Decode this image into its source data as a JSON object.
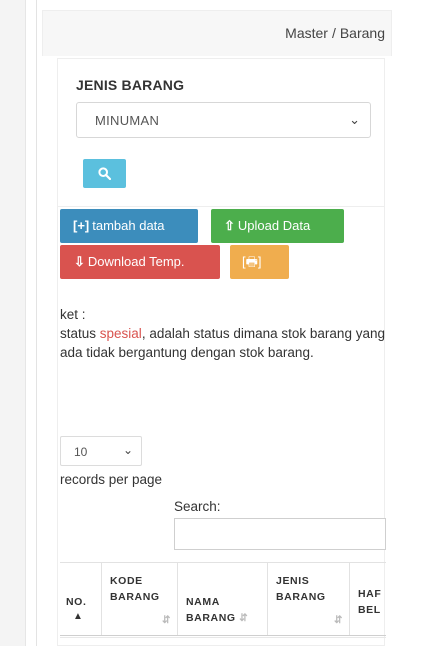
{
  "breadcrumb": {
    "parent": "Master",
    "separator": "/",
    "current": "Barang"
  },
  "filter": {
    "label": "JENIS BARANG",
    "selected": "MINUMAN"
  },
  "search_button": {
    "icon": "search-icon"
  },
  "buttons": {
    "tambah": "tambah data",
    "tambah_icon": "[+]",
    "upload": "Upload Data",
    "download": "Download Temp.",
    "print_icon": "[🖶]"
  },
  "colors": {
    "primary": "#3c8dbc",
    "success": "#4cae4c",
    "danger": "#d9534f",
    "warning": "#f0ad4e",
    "info": "#5bc0de"
  },
  "ket": {
    "title": "ket :",
    "prefix": "status ",
    "highlight": "spesial",
    "suffix": ", adalah status dimana stok barang yang ada tidak bergantung dengan stok barang."
  },
  "table": {
    "page_length": "10",
    "records_label": "records per page",
    "search_label": "Search:",
    "search_value": "",
    "columns": [
      {
        "line1": "",
        "line2": "NO."
      },
      {
        "line1": "KODE",
        "line2": "BARANG"
      },
      {
        "line1": "NAMA",
        "line2": "BARANG"
      },
      {
        "line1": "JENIS",
        "line2": "BARANG"
      },
      {
        "line1": "HAF",
        "line2": "BEL"
      }
    ]
  }
}
